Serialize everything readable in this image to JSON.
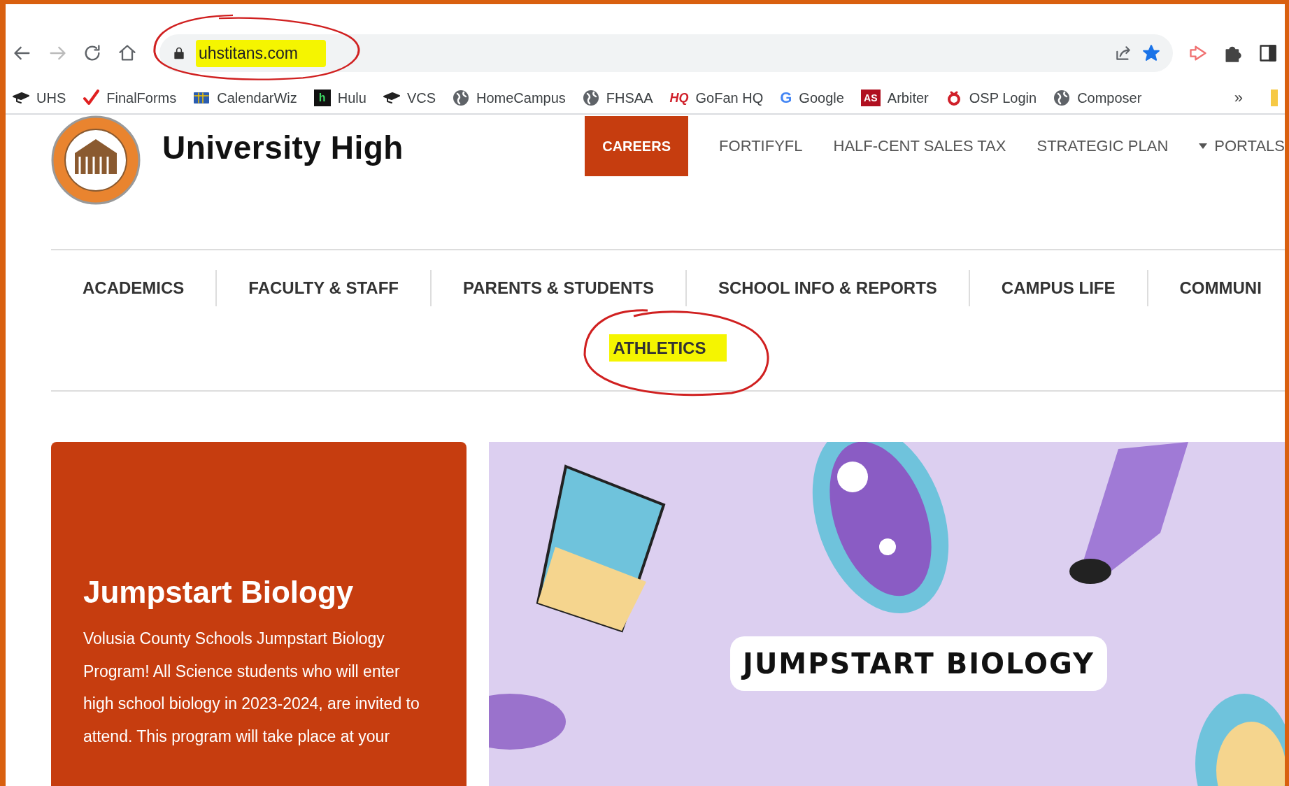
{
  "browser": {
    "back_disabled": false,
    "forward_disabled": true,
    "url": "uhstitans.com",
    "url_annotated": true,
    "starred": true,
    "bookmarks": [
      {
        "kind": "cap",
        "label": "UHS"
      },
      {
        "kind": "check",
        "label": "FinalForms"
      },
      {
        "kind": "calendar",
        "label": "CalendarWiz"
      },
      {
        "kind": "letter",
        "icon_text": "h",
        "label": "Hulu"
      },
      {
        "kind": "cap",
        "label": "VCS"
      },
      {
        "kind": "globe",
        "label": "HomeCampus"
      },
      {
        "kind": "globe",
        "label": "FHSAA"
      },
      {
        "kind": "logo_text",
        "icon_text": "HQ",
        "label": "GoFan HQ"
      },
      {
        "kind": "google",
        "icon_text": "G",
        "label": "Google"
      },
      {
        "kind": "badge",
        "icon_text": "AS",
        "label": "Arbiter"
      },
      {
        "kind": "ring",
        "label": "OSP Login"
      },
      {
        "kind": "globe",
        "label": "Composer"
      }
    ],
    "more": "»"
  },
  "site": {
    "title": "University High",
    "top_links": [
      {
        "kind": "button",
        "label": "CAREERS"
      },
      {
        "kind": "link",
        "label": "FORTIFYFL"
      },
      {
        "kind": "link",
        "label": "HALF-CENT SALES TAX"
      },
      {
        "kind": "link",
        "label": "STRATEGIC PLAN"
      },
      {
        "kind": "dropdown",
        "label": "PORTALS"
      }
    ],
    "nav": [
      {
        "label": "ACADEMICS",
        "annotated": false
      },
      {
        "label": "FACULTY & STAFF",
        "annotated": false
      },
      {
        "label": "PARENTS & STUDENTS",
        "annotated": false
      },
      {
        "label": "SCHOOL INFO & REPORTS",
        "annotated": false
      },
      {
        "label": "CAMPUS LIFE",
        "annotated": false
      },
      {
        "label": "COMMUNI",
        "annotated": false
      },
      {
        "label": "ATHLETICS",
        "annotated": true
      }
    ],
    "feature": {
      "title": "Jumpstart Biology",
      "text": "Volusia County Schools Jumpstart Biology Program! All Science students who will enter high school biology in 2023-2024, are invited to attend. This program will take place at your"
    },
    "banner": {
      "title": "JUMPSTART BIOLOGY"
    }
  }
}
